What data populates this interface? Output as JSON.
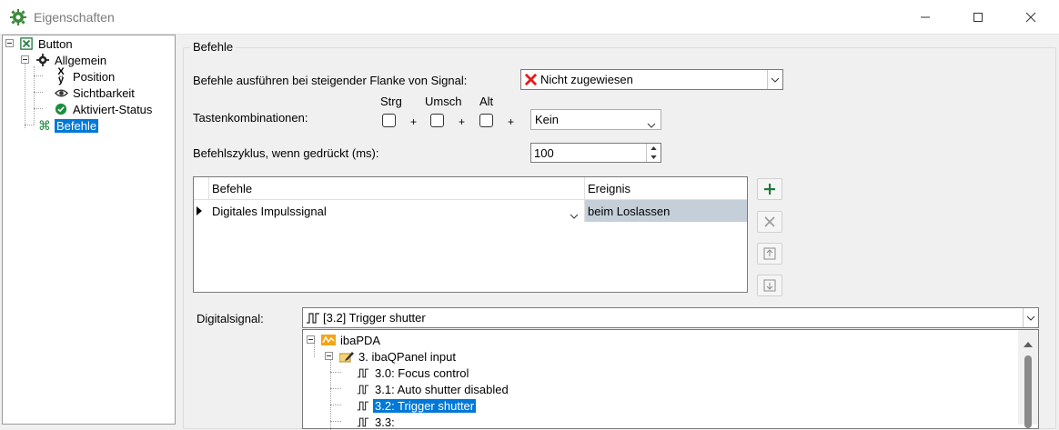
{
  "window": {
    "title": "Eigenschaften",
    "accent": "#0078d7"
  },
  "tree": {
    "items": [
      {
        "label": "Button",
        "icon": "excel-x-icon"
      },
      {
        "label": "Allgemein",
        "icon": "gear-icon"
      },
      {
        "label": "Position",
        "icon": "xy-icon"
      },
      {
        "label": "Sichtbarkeit",
        "icon": "eye-icon"
      },
      {
        "label": "Aktiviert-Status",
        "icon": "check-circle-icon"
      },
      {
        "label": "Befehle",
        "icon": "command-icon",
        "selected": true
      }
    ]
  },
  "group": {
    "title": "Befehle"
  },
  "form": {
    "signal_label": "Befehle ausführen bei steigender Flanke von Signal:",
    "signal_value": "Nicht zugewiesen",
    "keys_label": "Tastenkombinationen:",
    "mod_strg": "Strg",
    "mod_umsch": "Umsch",
    "mod_alt": "Alt",
    "plus": "+",
    "key_value": "Kein",
    "cycle_label": "Befehlszyklus, wenn gedrückt (ms):",
    "cycle_value": "100"
  },
  "grid": {
    "col_command": "Befehle",
    "col_event": "Ereignis",
    "rows": [
      {
        "command": "Digitales Impulssignal",
        "event": "beim Loslassen"
      }
    ]
  },
  "digital": {
    "label": "Digitalsignal:",
    "value": "[3.2] Trigger shutter",
    "tree": [
      {
        "label": "ibaPDA"
      },
      {
        "label": "3. ibaQPanel input"
      },
      {
        "label": "3.0: Focus control"
      },
      {
        "label": "3.1: Auto shutter disabled"
      },
      {
        "label": "3.2: Trigger shutter",
        "selected": true
      },
      {
        "label": "3.3:"
      }
    ]
  }
}
